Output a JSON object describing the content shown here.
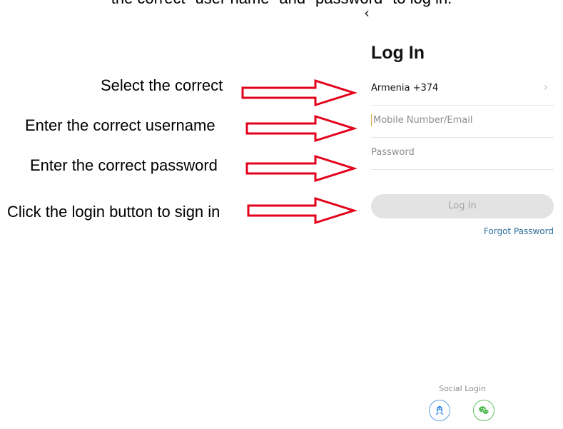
{
  "caption": "the correct \"user name\" and \"password\" to log in.",
  "app": {
    "back_icon": "chevron-left-icon",
    "title": "Log In",
    "country_field": {
      "value": "Armenia +374",
      "icon": "chevron-right-icon"
    },
    "username_field": {
      "placeholder": "Mobile Number/Email"
    },
    "password_field": {
      "placeholder": "Password"
    },
    "login_button": {
      "label": "Log In"
    },
    "forgot_password": "Forgot Password",
    "social_login": {
      "label": "Social Login",
      "icons": [
        "qq-icon",
        "wechat-icon"
      ]
    }
  },
  "annotations": [
    {
      "text": "Select the correct",
      "arrow_icon": "right-arrow-icon"
    },
    {
      "text": "Enter the correct username",
      "arrow_icon": "right-arrow-icon"
    },
    {
      "text": "Enter the correct password",
      "arrow_icon": "right-arrow-icon"
    },
    {
      "text": "Click the login button to sign in",
      "arrow_icon": "right-arrow-icon"
    }
  ],
  "colors": {
    "arrow_stroke": "#e3001b",
    "link": "#2f6f9c",
    "button_bg": "#e3e3e3",
    "qq": "#5aa0e4",
    "wechat": "#62c060"
  }
}
